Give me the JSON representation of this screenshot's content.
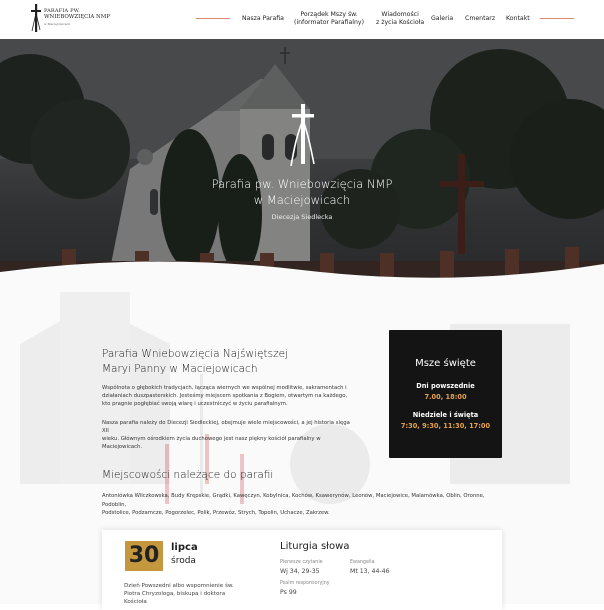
{
  "header": {
    "logo_line1": "PARAFIA PW.",
    "logo_line2": "WNIEBOWZIĘCIA NMP",
    "logo_line3": "w Maciejowicach",
    "nav": [
      {
        "label": "Nasza Parafia"
      },
      {
        "label": "Porządek Mszy św.",
        "label2": "(informator Parafialny)"
      },
      {
        "label": "Wiadomości",
        "label2": "z życia Kościoła"
      },
      {
        "label": "Galeria"
      },
      {
        "label": "Cmentarz"
      },
      {
        "label": "Kontakt"
      }
    ]
  },
  "hero": {
    "title_line1": "Parafia pw. Wniebowzięcia NMP",
    "title_line2": "w Maciejowicach",
    "subtitle": "Diecezja Siedlecka"
  },
  "intro": {
    "title_line1": "Parafia Wniebowzięcia Najświętszej",
    "title_line2": "Maryi Panny w Maciejowicach",
    "p1_lines": [
      "Wspólnota o głębokich tradycjach, łącząca wiernych we wspólnej modlitwie, sakramentach i",
      "działaniach duszpasterskich. Jesteśmy miejscem spotkania z Bogiem, otwartym na każdego,",
      "kto pragnie pogłębiać swoją wiarę i uczestniczyć w życiu parafialnym."
    ],
    "p2_lines": [
      "Nasza parafia należy do Diecezji Siedleckiej, obejmuje wiele miejscowości, a jej historia sięga XII",
      "wieku. Głównym ośrodkiem życia duchowego jest nasz piękny kościół parafialny w",
      "Maciejowicach."
    ]
  },
  "mass": {
    "title": "Msze święte",
    "weekday_label": "Dni powszednie",
    "weekday_times": "7.00, 18:00",
    "sunday_label": "Niedziele i święta",
    "sunday_times": "7:30, 9:30, 11:30, 17:00"
  },
  "places": {
    "title": "Miejscowości należące do parafii",
    "line1": "Antoniówka Wilczkowska, Budy Krępskie, Grądki, Kawęczyn, Kobylnica, Kochów, Ksawerynów, Leonów, Maciejowice, Malamówka, Oblin, Oronne, Podoblin,",
    "line2": "Podstolice, Podzamcze, Pogorzelec, Polik, Przewóz, Strych, Topolin, Uchacze, Zakrzew."
  },
  "calendar": {
    "day": "30",
    "month": "lipca",
    "weekday": "środa",
    "saint_lines": [
      "Dzień Powszedni albo wspomnienie św.",
      "Piotra Chryzologa, biskupa i doktora",
      "Kościoła"
    ],
    "liturgy_title": "Liturgia słowa",
    "first_reading_label": "Pierwsze czytanie",
    "first_reading": "Wj 34, 29-35",
    "gospel_label": "Ewangelia",
    "gospel": "Mt 13, 44-46",
    "psalm_label": "Psalm responsoryjny",
    "psalm": "Ps 99"
  },
  "colors": {
    "accent": "#d98a6e",
    "gold": "#c5973f",
    "mass_time": "#e7a24a",
    "mass_bg": "#141414"
  }
}
